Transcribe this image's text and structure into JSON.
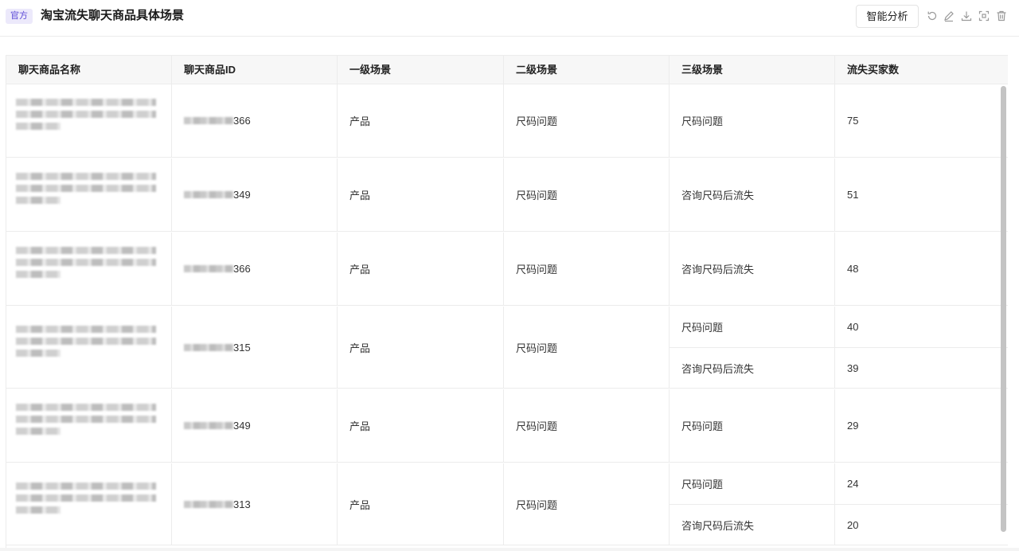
{
  "header": {
    "badge": "官方",
    "title": "淘宝流失聊天商品具体场景",
    "analyze_button": "智能分析",
    "tools": [
      "refresh-icon",
      "edit-icon",
      "download-icon",
      "fullscreen-icon",
      "delete-icon"
    ]
  },
  "table": {
    "columns": [
      "聊天商品名称",
      "聊天商品ID",
      "一级场景",
      "二级场景",
      "三级场景",
      "流失买家数"
    ],
    "rows": [
      {
        "id_suffix": "366",
        "level1": "产品",
        "level2": "尺码问题",
        "sub": [
          {
            "level3": "尺码问题",
            "count": "75"
          }
        ]
      },
      {
        "id_suffix": "349",
        "level1": "产品",
        "level2": "尺码问题",
        "sub": [
          {
            "level3": "咨询尺码后流失",
            "count": "51"
          }
        ]
      },
      {
        "id_suffix": "366",
        "level1": "产品",
        "level2": "尺码问题",
        "sub": [
          {
            "level3": "咨询尺码后流失",
            "count": "48"
          }
        ]
      },
      {
        "id_suffix": "315",
        "level1": "产品",
        "level2": "尺码问题",
        "sub": [
          {
            "level3": "尺码问题",
            "count": "40"
          },
          {
            "level3": "咨询尺码后流失",
            "count": "39"
          }
        ]
      },
      {
        "id_suffix": "349",
        "level1": "产品",
        "level2": "尺码问题",
        "sub": [
          {
            "level3": "尺码问题",
            "count": "29"
          }
        ]
      },
      {
        "id_suffix": "313",
        "level1": "产品",
        "level2": "尺码问题",
        "sub": [
          {
            "level3": "尺码问题",
            "count": "24"
          },
          {
            "level3": "咨询尺码后流失",
            "count": "20"
          }
        ]
      }
    ]
  },
  "colors": {
    "accent": "#5b49d6",
    "badge_bg": "#ece9fb",
    "header_bg": "#f7f7f7",
    "border": "#ececec"
  }
}
